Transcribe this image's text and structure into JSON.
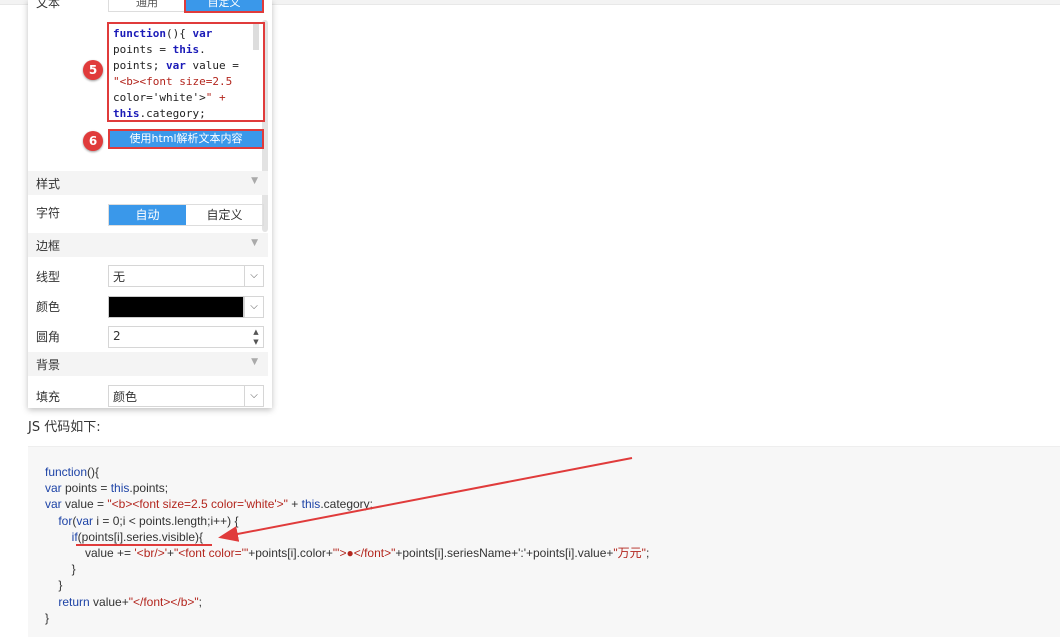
{
  "panel": {
    "top_label": "文本",
    "top_buttons": [
      "通用",
      "自定义"
    ],
    "editor_lines": [
      "function(){ var",
      "points = this.",
      "points; var value =",
      "\"<b><font size=2.5",
      "color='white'>\" +",
      "this.category;"
    ],
    "html_button": "使用html解析文本内容",
    "badges": [
      "5",
      "6"
    ],
    "sections": {
      "style": "样式",
      "border": "边框",
      "background": "背景"
    },
    "font_label": "字符",
    "font_options": [
      "自动",
      "自定义"
    ],
    "line_type_label": "线型",
    "line_type_value": "无",
    "color_label": "颜色",
    "color_value": "#000000",
    "radius_label": "圆角",
    "radius_value": "2",
    "fill_label": "填充",
    "fill_value": "颜色"
  },
  "caption": "JS 代码如下:",
  "code_lines": [
    "function(){",
    "var points = this.points;",
    "var value = \"<b><font size=2.5 color='white'>\" + this.category;",
    "    for(var i = 0;i < points.length;i++) {",
    "        if(points[i].series.visible){",
    "            value += '<br/>'+\"<font color='\"+points[i].color+\"'>●</font>\"+points[i].seriesName+':'+points[i].value+\"万元\";",
    "        }",
    "    }",
    "    return value+\"</font></b>\";",
    "}"
  ],
  "colors": {
    "accent": "#3a98ea",
    "highlight": "#e03b3b"
  }
}
